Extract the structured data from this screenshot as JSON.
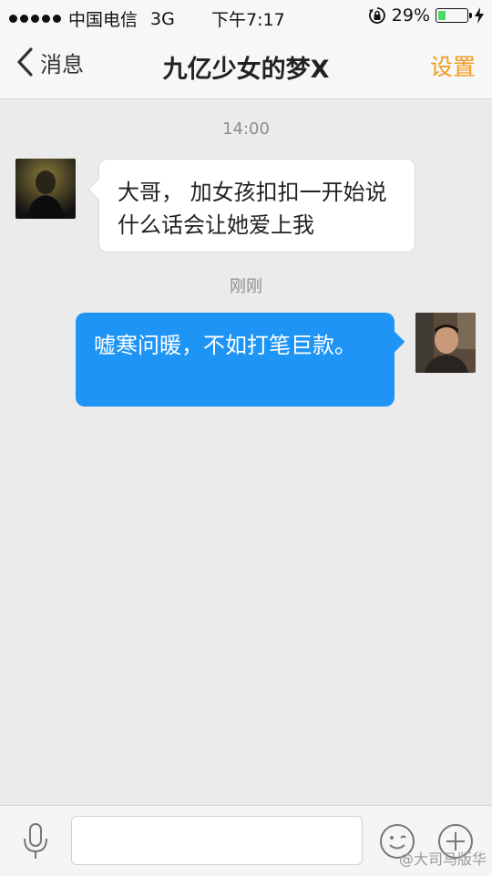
{
  "status_bar": {
    "carrier": "中国电信",
    "network": "3G",
    "time": "下午7:17",
    "battery_percent_label": "29%",
    "battery_level": 0.29
  },
  "nav": {
    "back_label": "消息",
    "title": "九亿少女的梦X",
    "settings_label": "设置"
  },
  "chat": {
    "timestamp_1": "14:00",
    "incoming_message": "大哥， 加女孩扣扣一开始说什么话会让她爱上我",
    "timestamp_2": "刚刚",
    "outgoing_message": "嘘寒问暖，不如打笔巨款。"
  },
  "input": {
    "placeholder": ""
  },
  "watermark": "@大司马版华",
  "colors": {
    "accent": "#f29b1f",
    "outgoing_bubble": "#1e95f5",
    "battery": "#4cd964"
  }
}
